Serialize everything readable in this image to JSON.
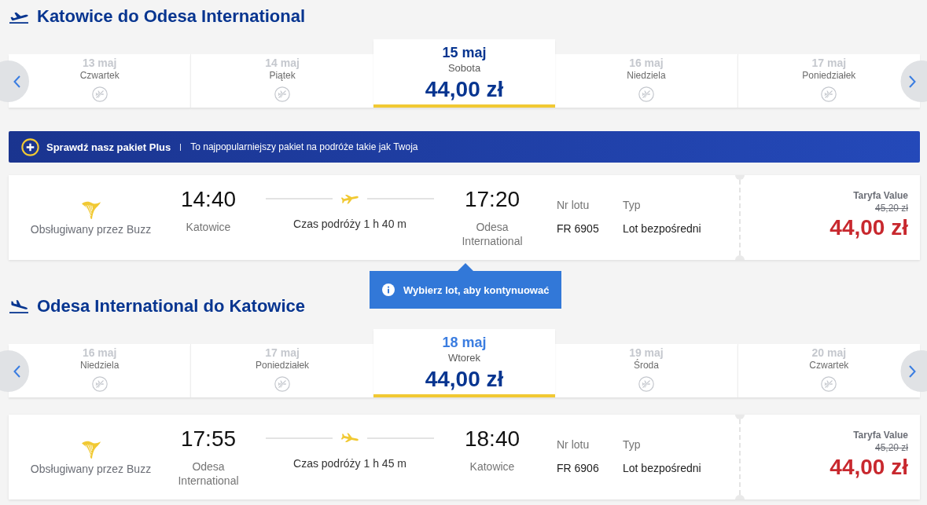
{
  "journeys": [
    {
      "kind": "outbound",
      "title": "Katowice do Odesa International",
      "days": [
        {
          "date": "13 maj",
          "weekday": "Czwartek",
          "available": false,
          "selected": false,
          "hovered": false
        },
        {
          "date": "14 maj",
          "weekday": "Piątek",
          "available": false,
          "selected": false,
          "hovered": false
        },
        {
          "date": "15 maj",
          "weekday": "Sobota",
          "price": "44,00 zł",
          "available": true,
          "selected": true,
          "hovered": false
        },
        {
          "date": "16 maj",
          "weekday": "Niedziela",
          "available": false,
          "selected": false,
          "hovered": false
        },
        {
          "date": "17 maj",
          "weekday": "Poniedziałek",
          "available": false,
          "selected": false,
          "hovered": false
        }
      ],
      "promo": {
        "title": "Sprawdź nasz pakiet Plus",
        "text": "To najpopularniejszy pakiet na podróże takie jak Twoja"
      },
      "flight": {
        "operator": "Obsługiwany przez Buzz",
        "departure_time": "14:40",
        "departure_airport": "Katowice",
        "duration": "Czas podróży 1 h 40 m",
        "arrival_time": "17:20",
        "arrival_airport": "Odesa International",
        "flight_number_label": "Nr lotu",
        "flight_number": "FR 6905",
        "type_label": "Typ",
        "type": "Lot bezpośredni",
        "fare_name": "Taryfa Value",
        "old_price": "45,20 zł",
        "price": "44,00 zł"
      },
      "tooltip": {
        "text": "Wybierz lot, aby kontynuować"
      }
    },
    {
      "kind": "return",
      "title": "Odesa International do Katowice",
      "days": [
        {
          "date": "16 maj",
          "weekday": "Niedziela",
          "available": false,
          "selected": false,
          "hovered": false
        },
        {
          "date": "17 maj",
          "weekday": "Poniedziałek",
          "available": false,
          "selected": false,
          "hovered": false
        },
        {
          "date": "18 maj",
          "weekday": "Wtorek",
          "price": "44,00 zł",
          "available": true,
          "selected": true,
          "hovered": true
        },
        {
          "date": "19 maj",
          "weekday": "Środa",
          "available": false,
          "selected": false,
          "hovered": false
        },
        {
          "date": "20 maj",
          "weekday": "Czwartek",
          "available": false,
          "selected": false,
          "hovered": false
        }
      ],
      "flight": {
        "operator": "Obsługiwany przez Buzz",
        "departure_time": "17:55",
        "departure_airport": "Odesa International",
        "duration": "Czas podróży 1 h 45 m",
        "arrival_time": "18:40",
        "arrival_airport": "Katowice",
        "flight_number_label": "Nr lotu",
        "flight_number": "FR 6906",
        "type_label": "Typ",
        "type": "Lot bezpośredni",
        "fare_name": "Taryfa Value",
        "old_price": "45,20 zł",
        "price": "44,00 zł"
      }
    }
  ]
}
